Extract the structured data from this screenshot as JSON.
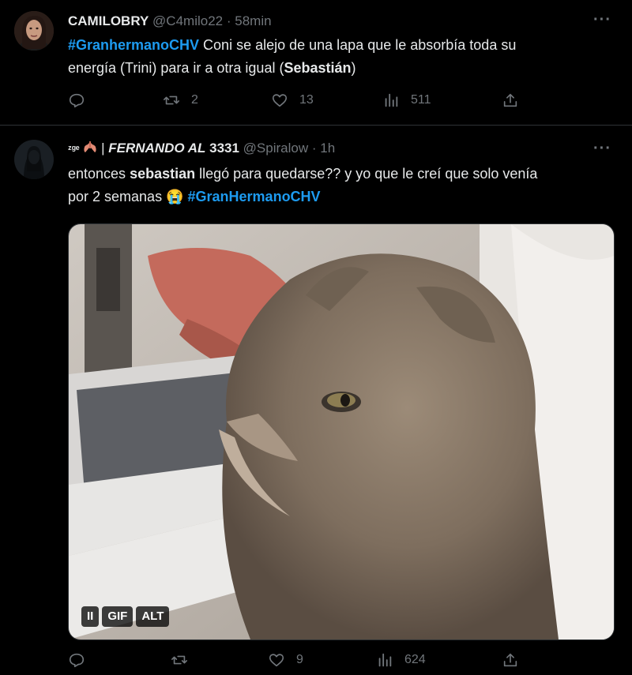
{
  "tweets": [
    {
      "display_name": "CAMILOBRY",
      "handle": "@C4milo22",
      "time": "58min",
      "text_parts": {
        "hashtag": "#GranhermanoCHV",
        "t1": " Coni se alejo de una lapa que le absorbía toda su",
        "t2": "energía (Trini) para ir a otra igual (",
        "bold": "Sebastián",
        "t3": ")"
      },
      "actions": {
        "reply": "",
        "retweet": "2",
        "like": "13",
        "views": "511"
      }
    },
    {
      "display_name_emoji": "ᶻᵍᵉ",
      "display_name_sep": "| ",
      "display_name": "FERNANDO AL",
      "display_name_num": "3331",
      "handle": "@Spiralow",
      "time": "1h",
      "text_parts": {
        "t1": "entonces ",
        "bold": "sebastian",
        "t2": " llegó para quedarse?? y yo que le creí que solo venía",
        "t3": "por 2 semanas ",
        "emoji": "😭",
        "hashtag": "#GranHermanoCHV"
      },
      "media": {
        "badges": {
          "pause": "II",
          "gif": "GIF",
          "alt": "ALT"
        }
      },
      "actions": {
        "reply": "",
        "retweet": "",
        "like": "9",
        "views": "624"
      }
    }
  ],
  "icons": {
    "more": "more-icon",
    "reply": "reply-icon",
    "retweet": "retweet-icon",
    "like": "heart-icon",
    "views": "views-icon",
    "share": "share-icon"
  },
  "colors": {
    "background": "#000000",
    "hashtag": "#1d9bf0",
    "muted": "#71767b",
    "text": "#e7e9ea"
  }
}
